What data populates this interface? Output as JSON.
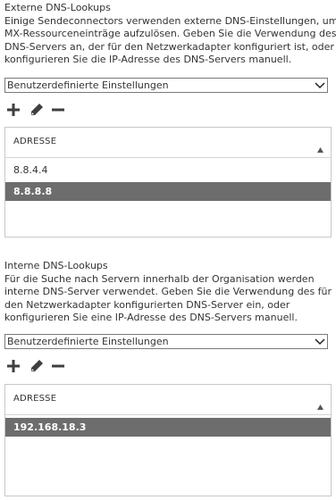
{
  "external": {
    "title": "Externe DNS-Lookups",
    "description_lines": [
      "Einige Sendeconnectors verwenden externe DNS-Einstellungen, um",
      "MX-Ressourceneinträge aufzulösen. Geben Sie die Verwendung des",
      "DNS-Servers an, der für den Netzwerkadapter konfiguriert ist, oder",
      "konfigurieren Sie die IP-Adresse des DNS-Servers manuell."
    ],
    "select_value": "Benutzerdefinierte Einstellungen",
    "toolbar": {
      "add_icon": "plus-icon",
      "edit_icon": "pencil-icon",
      "remove_icon": "minus-icon"
    },
    "column_header": "ADRESSE",
    "rows": [
      "8.8.4.4",
      "8.8.8.8"
    ],
    "selected_row": "8.8.8.8"
  },
  "internal": {
    "title": "Interne DNS-Lookups",
    "description_lines": [
      "Für die Suche nach Servern innerhalb der Organisation werden",
      "interne DNS-Server verwendet. Geben Sie die Verwendung des für",
      "den Netzwerkadapter konfigurierten DNS-Server ein, oder",
      "konfigurieren Sie eine IP-Adresse des DNS-Servers manuell."
    ],
    "select_value": "Benutzerdefinierte Einstellungen",
    "toolbar": {
      "add_icon": "plus-icon",
      "edit_icon": "pencil-icon",
      "remove_icon": "minus-icon"
    },
    "column_header": "ADRESSE",
    "rows": [
      "192.168.18.3"
    ],
    "selected_row": "192.168.18.3"
  },
  "colors": {
    "text": "#333333",
    "selected_row_bg": "#6d6d6d",
    "selected_row_text": "#ffffff",
    "border": "#c8c8c8",
    "icon": "#3f3f3f"
  }
}
